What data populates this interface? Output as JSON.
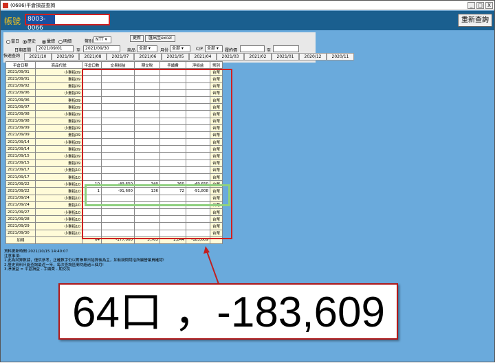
{
  "window": {
    "title": "(0686)平倉損益查詢",
    "buttons": [
      "_",
      "□",
      "X"
    ]
  },
  "account": {
    "label": "帳號",
    "value": "8003-0066"
  },
  "refresh_label": "重新查詢",
  "filters": {
    "range_today": "當日",
    "range_history": "歷史",
    "mode_summary": "彙總",
    "mode_detail": "明細",
    "currency_label": "幣別",
    "currency_value": "NTT",
    "update_button": "更新",
    "export_button": "匯出至excel",
    "date_label": "日期區間",
    "date_from": "2021/09/01",
    "date_to_label": "至",
    "date_to": "2021/09/30",
    "product_label": "商品",
    "product_value": "全部",
    "month_label": "月份",
    "month_value": "全部",
    "cp_label": "C/P",
    "cp_value": "全部",
    "strike_label": "履約價",
    "strike_to_label": "至",
    "quick_label": "快速查詢"
  },
  "quick_tabs": [
    "2021/10",
    "2021/09",
    "2021/08",
    "2021/07",
    "2021/06",
    "2021/05",
    "2021/04",
    "2021/03",
    "2021/02",
    "2021/01",
    "2020/12",
    "2020/11"
  ],
  "table": {
    "headers": [
      "平倉日期",
      "商品代號",
      "平倉口數",
      "交易損益",
      "期交稅",
      "手續費",
      "淨損益",
      "幣別"
    ],
    "rows": [
      [
        "2021/09/01",
        "小臺指09",
        "",
        "",
        "",
        "",
        "",
        "台幣"
      ],
      [
        "2021/09/01",
        "臺指09",
        "",
        "",
        "",
        "",
        "",
        "台幣"
      ],
      [
        "2021/09/02",
        "臺指09",
        "",
        "",
        "",
        "",
        "",
        "台幣"
      ],
      [
        "2021/09/06",
        "小臺指09",
        "",
        "",
        "",
        "",
        "",
        "台幣"
      ],
      [
        "2021/09/06",
        "臺指09",
        "",
        "",
        "",
        "",
        "",
        "台幣"
      ],
      [
        "2021/09/07",
        "臺指09",
        "",
        "",
        "",
        "",
        "",
        "台幣"
      ],
      [
        "2021/09/08",
        "小臺指09",
        "",
        "",
        "",
        "",
        "",
        "台幣"
      ],
      [
        "2021/09/08",
        "臺指09",
        "",
        "",
        "",
        "",
        "",
        "台幣"
      ],
      [
        "2021/09/09",
        "小臺指09",
        "",
        "",
        "",
        "",
        "",
        "台幣"
      ],
      [
        "2021/09/09",
        "臺指09",
        "",
        "",
        "",
        "",
        "",
        "台幣"
      ],
      [
        "2021/09/14",
        "小臺指09",
        "",
        "",
        "",
        "",
        "",
        "台幣"
      ],
      [
        "2021/09/14",
        "臺指09",
        "",
        "",
        "",
        "",
        "",
        "台幣"
      ],
      [
        "2021/09/15",
        "小臺指09",
        "",
        "",
        "",
        "",
        "",
        "台幣"
      ],
      [
        "2021/09/15",
        "臺指09",
        "",
        "",
        "",
        "",
        "",
        "台幣"
      ],
      [
        "2021/09/17",
        "小臺指10",
        "",
        "",
        "",
        "",
        "",
        "台幣"
      ],
      [
        "2021/09/17",
        "臺指10",
        "",
        "",
        "",
        "",
        "",
        "台幣"
      ],
      [
        "2021/09/22",
        "小臺指10",
        "10",
        "-49,650",
        "340",
        "360",
        "-49,650",
        "台幣"
      ],
      [
        "2021/09/22",
        "臺指10",
        "1",
        "-91,600",
        "136",
        "72",
        "-91,808",
        "台幣"
      ],
      [
        "2021/09/24",
        "小臺指10",
        "",
        "",
        "",
        "",
        "",
        "台幣"
      ],
      [
        "2021/09/24",
        "臺指10",
        "",
        "",
        "",
        "",
        "",
        "台幣"
      ],
      [
        "2021/09/27",
        "小臺指10",
        "",
        "",
        "",
        "",
        "",
        "台幣"
      ],
      [
        "2021/09/28",
        "小臺指10",
        "",
        "",
        "",
        "",
        "",
        "台幣"
      ],
      [
        "2021/09/29",
        "小臺指10",
        "",
        "",
        "",
        "",
        "",
        "台幣"
      ],
      [
        "2021/09/30",
        "小臺指10",
        "",
        "",
        "",
        "",
        "",
        "台幣"
      ]
    ],
    "total": [
      "加總",
      "",
      "64",
      "-177,000",
      "3,765",
      "2,844",
      "-183,609",
      ""
    ]
  },
  "notes": [
    "資料更新時間:2021/10/15 14:40:07",
    "注意事項:",
    "1.此為試算數據，僅供參考，正確數字仍以對帳單日結算後為主，如有疑問請洽所屬營業員確認!",
    "2.歷史資料只能查詢最近一年，每次查詢區間勿超過三個月!",
    "3.淨損益 = 平倉損益 - 手續費 - 期交稅"
  ],
  "zoom_text": "64口 ，-183,609",
  "colors": {
    "header_bar": "#1a5f8f",
    "background": "#6aaadc",
    "highlight_red": "#d02020",
    "highlight_green": "#8fd07f"
  }
}
